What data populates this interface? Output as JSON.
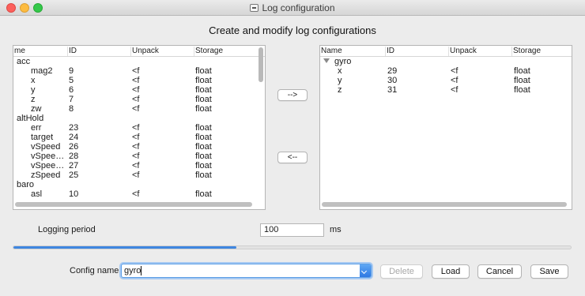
{
  "window": {
    "title": "Log configuration"
  },
  "heading": "Create and modify log configurations",
  "left_table": {
    "columns": [
      "me",
      "ID",
      "Unpack",
      "Storage"
    ],
    "rows": [
      {
        "name": "acc",
        "id": "",
        "unpack": "",
        "storage": "",
        "group": true
      },
      {
        "name": "mag2",
        "id": "9",
        "unpack": "<f",
        "storage": "float"
      },
      {
        "name": "x",
        "id": "5",
        "unpack": "<f",
        "storage": "float"
      },
      {
        "name": "y",
        "id": "6",
        "unpack": "<f",
        "storage": "float"
      },
      {
        "name": "z",
        "id": "7",
        "unpack": "<f",
        "storage": "float"
      },
      {
        "name": "zw",
        "id": "8",
        "unpack": "<f",
        "storage": "float"
      },
      {
        "name": "altHold",
        "id": "",
        "unpack": "",
        "storage": "",
        "group": true
      },
      {
        "name": "err",
        "id": "23",
        "unpack": "<f",
        "storage": "float"
      },
      {
        "name": "target",
        "id": "24",
        "unpack": "<f",
        "storage": "float"
      },
      {
        "name": "vSpeed",
        "id": "26",
        "unpack": "<f",
        "storage": "float"
      },
      {
        "name": "vSpee…",
        "id": "28",
        "unpack": "<f",
        "storage": "float"
      },
      {
        "name": "vSpee…",
        "id": "27",
        "unpack": "<f",
        "storage": "float"
      },
      {
        "name": "zSpeed",
        "id": "25",
        "unpack": "<f",
        "storage": "float"
      },
      {
        "name": "baro",
        "id": "",
        "unpack": "",
        "storage": "",
        "group": true
      },
      {
        "name": "asl",
        "id": "10",
        "unpack": "<f",
        "storage": "float"
      }
    ]
  },
  "right_table": {
    "columns": [
      "Name",
      "ID",
      "Unpack",
      "Storage"
    ],
    "rows": [
      {
        "name": "gyro",
        "id": "",
        "unpack": "",
        "storage": "",
        "group": true,
        "expanded": true
      },
      {
        "name": "x",
        "id": "29",
        "unpack": "<f",
        "storage": "float"
      },
      {
        "name": "y",
        "id": "30",
        "unpack": "<f",
        "storage": "float"
      },
      {
        "name": "z",
        "id": "31",
        "unpack": "<f",
        "storage": "float"
      }
    ]
  },
  "buttons": {
    "add": "-->",
    "remove": "<--",
    "delete": "Delete",
    "load": "Load",
    "cancel": "Cancel",
    "save": "Save"
  },
  "logging_period": {
    "label": "Logging period",
    "value": "100",
    "unit": "ms"
  },
  "progress": {
    "fraction": 0.4
  },
  "config_name": {
    "label": "Config name",
    "value": "gyro"
  },
  "colors": {
    "accent": "#3f86e0"
  }
}
